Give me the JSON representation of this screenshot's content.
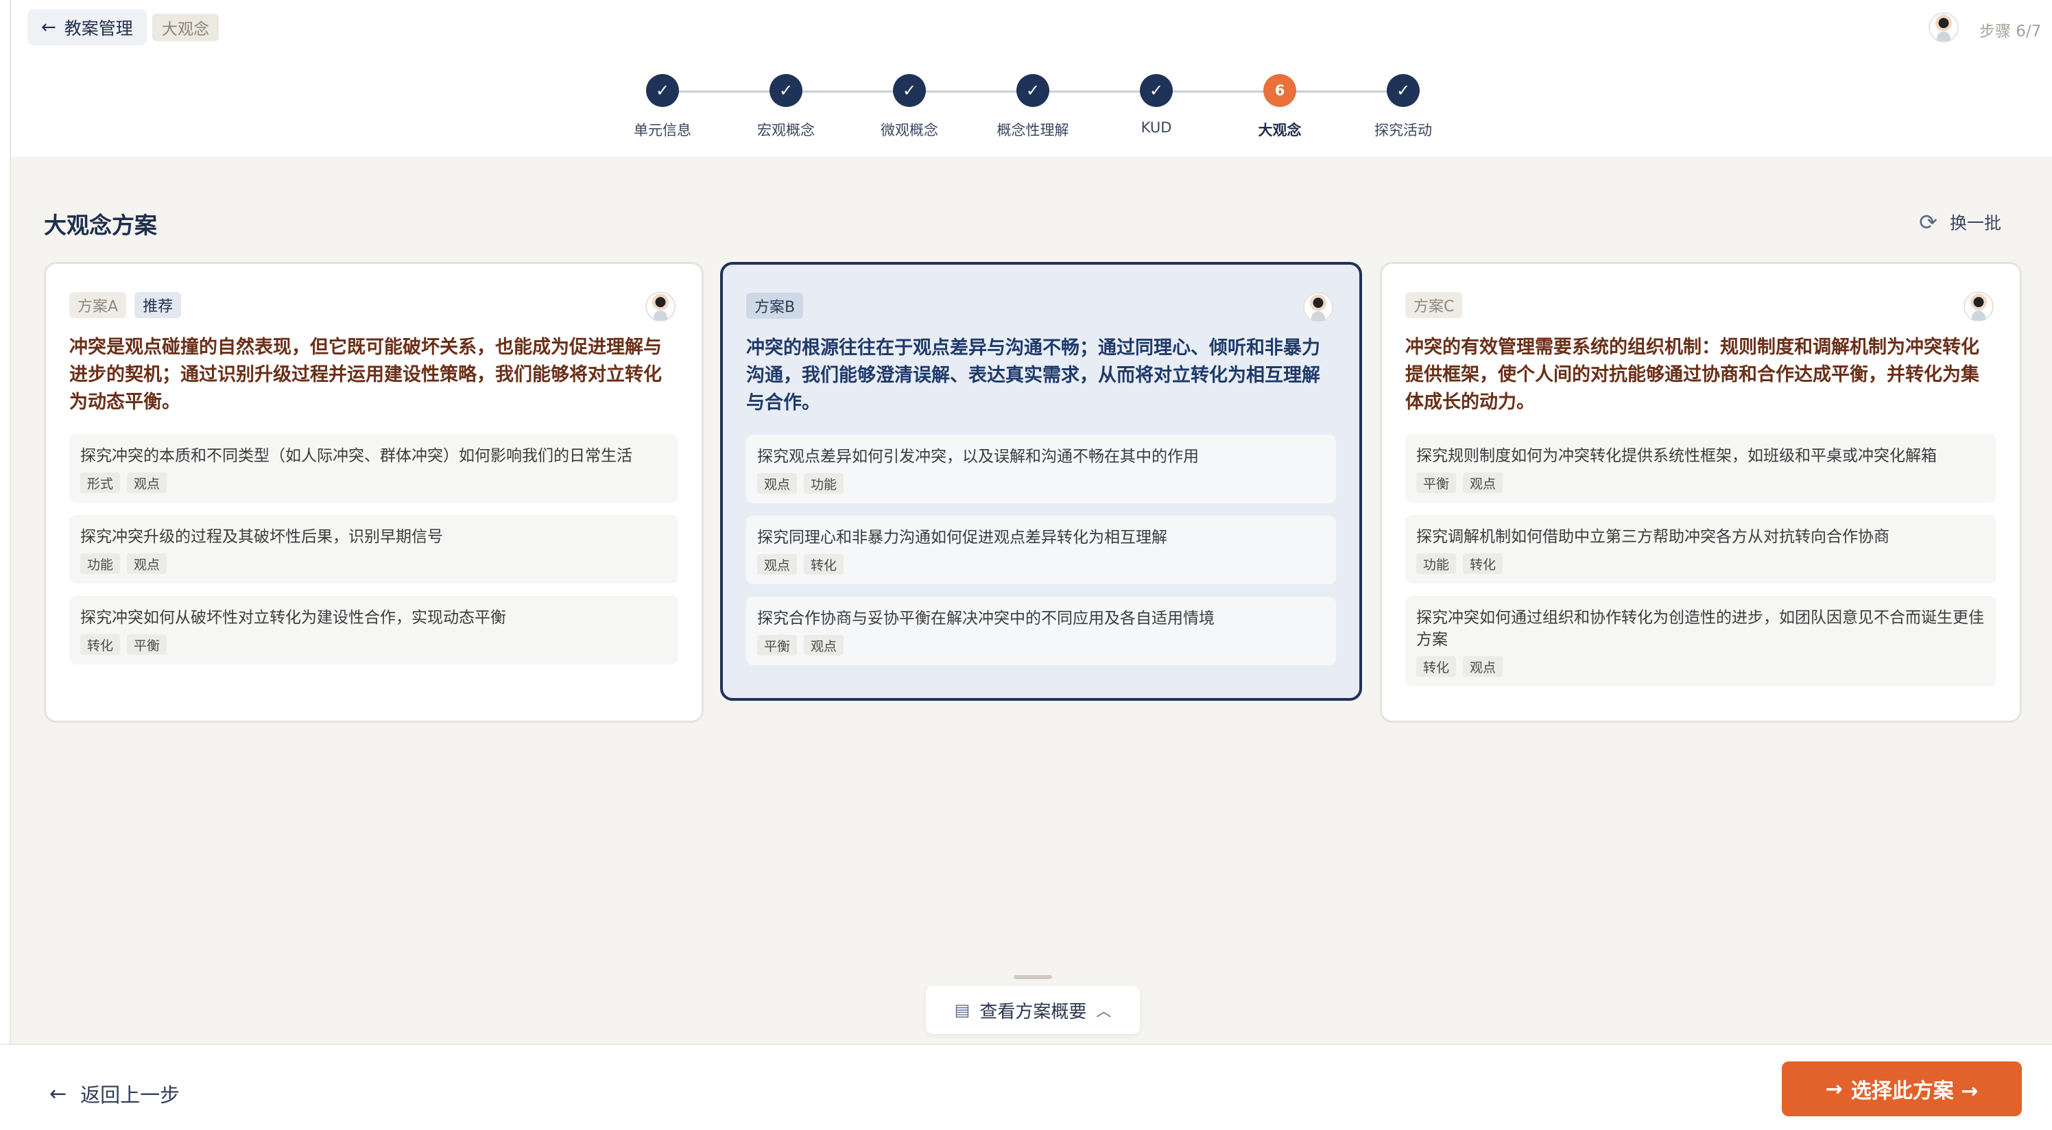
{
  "header": {
    "back_label": "教案管理",
    "breadcrumb": "大观念",
    "step_indicator": "步骤 6/7"
  },
  "stepper": {
    "steps": [
      {
        "label": "单元信息",
        "state": "done"
      },
      {
        "label": "宏观概念",
        "state": "done"
      },
      {
        "label": "微观概念",
        "state": "done"
      },
      {
        "label": "概念性理解",
        "state": "done"
      },
      {
        "label": "KUD",
        "state": "done"
      },
      {
        "label": "大观念",
        "state": "current",
        "number": "6"
      },
      {
        "label": "探究活动",
        "state": "done"
      }
    ]
  },
  "section": {
    "title": "大观念方案",
    "refresh_label": "换一批"
  },
  "cards": [
    {
      "plan_label": "方案A",
      "recommended_label": "推荐",
      "statement": "冲突是观点碰撞的自然表现，但它既可能破坏关系，也能成为促进理解与进步的契机；通过识别升级过程并运用建设性策略，我们能够将对立转化为动态平衡。",
      "items": [
        {
          "text": "探究冲突的本质和不同类型（如人际冲突、群体冲突）如何影响我们的日常生活",
          "tags": [
            "形式",
            "观点"
          ]
        },
        {
          "text": "探究冲突升级的过程及其破坏性后果，识别早期信号",
          "tags": [
            "功能",
            "观点"
          ]
        },
        {
          "text": "探究冲突如何从破坏性对立转化为建设性合作，实现动态平衡",
          "tags": [
            "转化",
            "平衡"
          ]
        }
      ]
    },
    {
      "plan_label": "方案B",
      "selected": true,
      "statement": "冲突的根源往往在于观点差异与沟通不畅；通过同理心、倾听和非暴力沟通，我们能够澄清误解、表达真实需求，从而将对立转化为相互理解与合作。",
      "items": [
        {
          "text": "探究观点差异如何引发冲突，以及误解和沟通不畅在其中的作用",
          "tags": [
            "观点",
            "功能"
          ]
        },
        {
          "text": "探究同理心和非暴力沟通如何促进观点差异转化为相互理解",
          "tags": [
            "观点",
            "转化"
          ]
        },
        {
          "text": "探究合作协商与妥协平衡在解决冲突中的不同应用及各自适用情境",
          "tags": [
            "平衡",
            "观点"
          ]
        }
      ]
    },
    {
      "plan_label": "方案C",
      "statement": "冲突的有效管理需要系统的组织机制：规则制度和调解机制为冲突转化提供框架，使个人间的对抗能够通过协商和合作达成平衡，并转化为集体成长的动力。",
      "items": [
        {
          "text": "探究规则制度如何为冲突转化提供系统性框架，如班级和平桌或冲突化解箱",
          "tags": [
            "平衡",
            "观点"
          ]
        },
        {
          "text": "探究调解机制如何借助中立第三方帮助冲突各方从对抗转向合作协商",
          "tags": [
            "功能",
            "转化"
          ]
        },
        {
          "text": "探究冲突如何通过组织和协作转化为创造性的进步，如团队因意见不合而诞生更佳方案",
          "tags": [
            "转化",
            "观点"
          ]
        }
      ]
    }
  ],
  "drawer": {
    "overview_label": "查看方案概要"
  },
  "footer": {
    "prev_label": "返回上一步",
    "choose_label": "选择此方案 →"
  },
  "colors": {
    "navy": "#1f3358",
    "accent_orange": "#e2622b",
    "current_step": "#e8703a",
    "selected_card_bg": "#e8edf5"
  }
}
